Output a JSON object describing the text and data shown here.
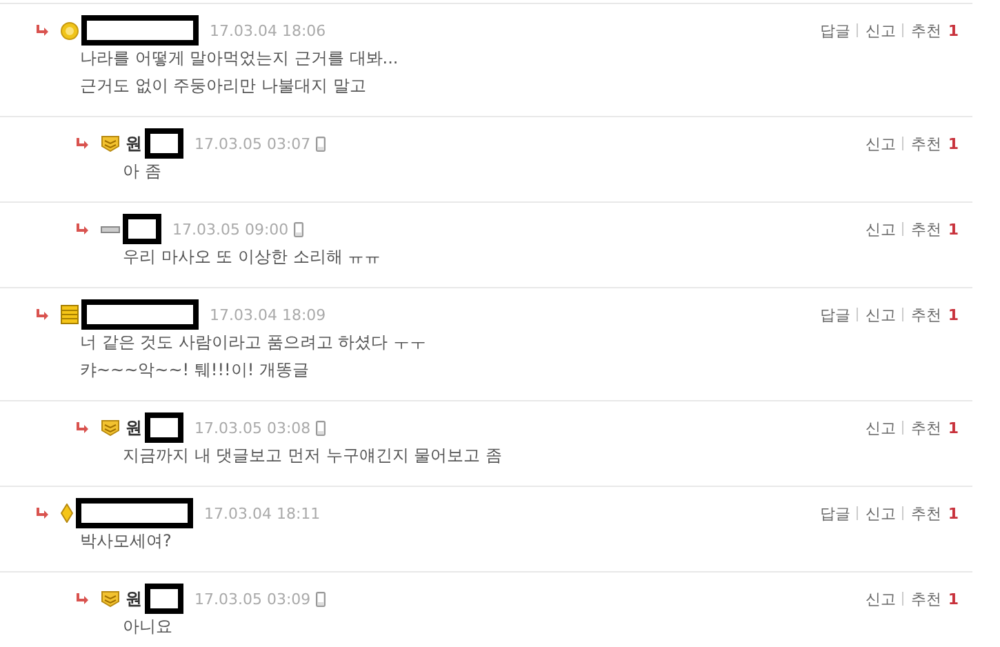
{
  "comments": [
    {
      "kind": "sun",
      "name_hidden": true,
      "time": "17.03.04 18:06",
      "mobile": false,
      "lines": [
        "나라를 어떻게 말아먹었는지 근거를 대봐...",
        "근거도 없이 주둥아리만 나불대지 말고"
      ],
      "actions": [
        "답글",
        "신고",
        "추천"
      ],
      "votes": "1",
      "children": [
        {
          "kind": "chevrons",
          "name_prefix": "원",
          "name_hidden": true,
          "time": "17.03.05 03:07",
          "mobile": true,
          "lines": [
            "아 좀"
          ],
          "actions": [
            "신고",
            "추천"
          ],
          "votes": "1"
        },
        {
          "kind": "bar",
          "name_hidden": true,
          "time": "17.03.05 09:00",
          "mobile": true,
          "lines": [
            "우리 마사오 또 이상한 소리해 ㅠㅠ"
          ],
          "actions": [
            "신고",
            "추천"
          ],
          "votes": "1"
        }
      ]
    },
    {
      "kind": "stack",
      "name_hidden": true,
      "time": "17.03.04 18:09",
      "mobile": false,
      "lines": [
        "너 같은 것도 사람이라고 품으려고 하셨다 ㅜㅜ",
        "캬~~~악~~! 퉤!!!이! 개똥글"
      ],
      "actions": [
        "답글",
        "신고",
        "추천"
      ],
      "votes": "1",
      "children": [
        {
          "kind": "chevrons",
          "name_prefix": "원",
          "name_hidden": true,
          "time": "17.03.05 03:08",
          "mobile": true,
          "lines": [
            "지금까지 내 댓글보고 먼저 누구얘긴지 물어보고 좀"
          ],
          "actions": [
            "신고",
            "추천"
          ],
          "votes": "1"
        }
      ]
    },
    {
      "kind": "diamond",
      "name_hidden": true,
      "time": "17.03.04 18:11",
      "mobile": false,
      "lines": [
        "박사모세여?"
      ],
      "actions": [
        "답글",
        "신고",
        "추천"
      ],
      "votes": "1",
      "children": [
        {
          "kind": "chevrons",
          "name_prefix": "원",
          "name_hidden": true,
          "time": "17.03.05 03:09",
          "mobile": true,
          "lines": [
            "아니요"
          ],
          "actions": [
            "신고",
            "추천"
          ],
          "votes": "1"
        }
      ]
    }
  ]
}
